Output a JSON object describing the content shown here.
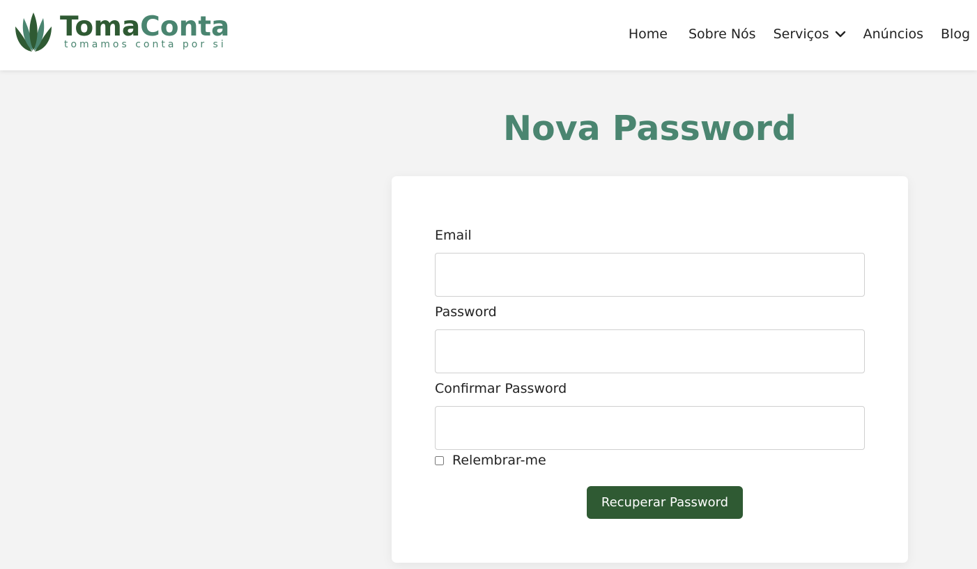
{
  "brand": {
    "name_part1": "Toma",
    "name_part2": "Conta",
    "tagline": "tomamos conta por si",
    "colors": {
      "dark_green": "#2f5a33",
      "teal_green": "#4a8570"
    },
    "logo_icon": "lotus-leaf-icon"
  },
  "nav": {
    "items": [
      {
        "label": "Home"
      },
      {
        "label": "Sobre Nós"
      },
      {
        "label": "Serviços",
        "icon": "chevron-down-icon"
      },
      {
        "label": "Anúncios"
      },
      {
        "label": "Blog"
      }
    ]
  },
  "page": {
    "title": "Nova Password"
  },
  "form": {
    "email": {
      "label": "Email",
      "value": ""
    },
    "password": {
      "label": "Password",
      "value": ""
    },
    "confirm_password": {
      "label": "Confirmar Password",
      "value": ""
    },
    "remember": {
      "label": "Relembrar-me",
      "checked": false
    },
    "submit_label": "Recuperar Password"
  }
}
